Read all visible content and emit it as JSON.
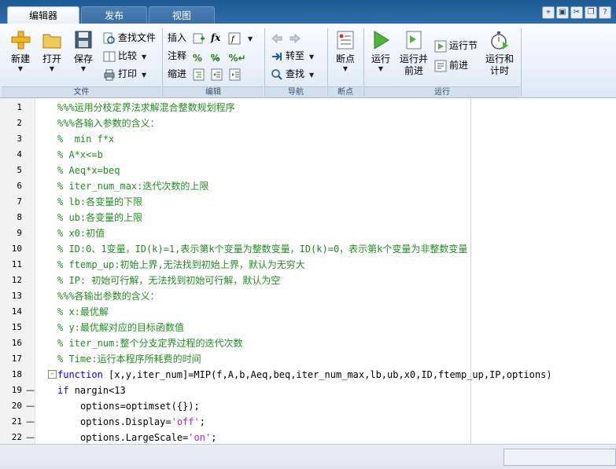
{
  "tabs": [
    {
      "label": "编辑器",
      "active": true
    },
    {
      "label": "发布",
      "active": false
    },
    {
      "label": "视图",
      "active": false
    }
  ],
  "quick_access_icons": [
    "pin-icon",
    "save-icon",
    "cut-icon",
    "copy-icon",
    "help-icon"
  ],
  "ribbon": {
    "file": {
      "group_label": "文件",
      "new": "新建",
      "open": "打开",
      "save": "保存",
      "find_file": "查找文件",
      "compare": "比较",
      "print": "打印"
    },
    "edit": {
      "group_label": "编辑",
      "insert": "插入",
      "comment": "注释",
      "indent": "缩进",
      "fx": "fx"
    },
    "navigate": {
      "group_label": "导航",
      "goto": "转至",
      "find": "查找"
    },
    "breakpoints": {
      "group_label": "断点",
      "breakpoints": "断点"
    },
    "run": {
      "group_label": "运行",
      "run": "运行",
      "run_advance": "运行并\n前进",
      "run_section": "运行节",
      "advance": "前进",
      "run_time": "运行和\n计时"
    }
  },
  "editor": {
    "lines": [
      {
        "n": "1",
        "segments": [
          {
            "t": "%%%运用分枝定界法求解混合整数规划程序",
            "c": "comment"
          }
        ]
      },
      {
        "n": "2",
        "segments": [
          {
            "t": "%%%各输入参数的含义：",
            "c": "comment"
          }
        ]
      },
      {
        "n": "3",
        "segments": [
          {
            "t": "%  min f*x",
            "c": "comment"
          }
        ]
      },
      {
        "n": "4",
        "segments": [
          {
            "t": "% A*x<=b",
            "c": "comment"
          }
        ]
      },
      {
        "n": "5",
        "segments": [
          {
            "t": "% Aeq*x=beq",
            "c": "comment"
          }
        ]
      },
      {
        "n": "6",
        "segments": [
          {
            "t": "% iter_num_max:迭代次数的上限",
            "c": "comment"
          }
        ]
      },
      {
        "n": "7",
        "segments": [
          {
            "t": "% lb:各变量的下限",
            "c": "comment"
          }
        ]
      },
      {
        "n": "8",
        "segments": [
          {
            "t": "% ub:各变量的上限",
            "c": "comment"
          }
        ]
      },
      {
        "n": "9",
        "segments": [
          {
            "t": "% x0:初值",
            "c": "comment"
          }
        ]
      },
      {
        "n": "10",
        "segments": [
          {
            "t": "% ID:0、1变量，ID(k)=1,表示第k个变量为整数变量，ID(k)=0，表示第k个变量为非整数变量",
            "c": "comment"
          }
        ]
      },
      {
        "n": "11",
        "segments": [
          {
            "t": "% ftemp_up:初始上界,无法找到初始上界，默认为无穷大",
            "c": "comment"
          }
        ]
      },
      {
        "n": "12",
        "segments": [
          {
            "t": "% IP: 初始可行解，无法找到初始可行解，默认为空",
            "c": "comment"
          }
        ]
      },
      {
        "n": "13",
        "segments": [
          {
            "t": "%%%各输出参数的含义：",
            "c": "comment"
          }
        ]
      },
      {
        "n": "14",
        "segments": [
          {
            "t": "% x:最优解",
            "c": "comment"
          }
        ]
      },
      {
        "n": "15",
        "segments": [
          {
            "t": "% y:最优解对应的目标函数值",
            "c": "comment"
          }
        ]
      },
      {
        "n": "16",
        "segments": [
          {
            "t": "% iter_num:整个分支定界过程的迭代次数",
            "c": "comment"
          }
        ]
      },
      {
        "n": "17",
        "segments": [
          {
            "t": "% Time:运行本程序所耗费的时间",
            "c": "comment"
          }
        ]
      },
      {
        "n": "18",
        "fold": "-",
        "segments": [
          {
            "t": "function",
            "c": "kw"
          },
          {
            "t": " [x,y,iter_num]=MIP(f,A,b,Aeq,beq,iter_num_max,lb,ub,x0,ID,ftemp_up,IP,options)",
            "c": "plain"
          }
        ]
      },
      {
        "n": "19",
        "dash": "—",
        "segments": [
          {
            "t": "if",
            "c": "kw"
          },
          {
            "t": " nargin<13",
            "c": "plain"
          }
        ]
      },
      {
        "n": "20",
        "dash": "—",
        "indent": true,
        "segments": [
          {
            "t": "options=optimset({});",
            "c": "plain"
          }
        ]
      },
      {
        "n": "21",
        "dash": "—",
        "indent": true,
        "segments": [
          {
            "t": "options.Display=",
            "c": "plain"
          },
          {
            "t": "'off'",
            "c": "str"
          },
          {
            "t": ";",
            "c": "plain"
          }
        ]
      },
      {
        "n": "22",
        "dash": "—",
        "indent": true,
        "segments": [
          {
            "t": "options.LargeScale=",
            "c": "plain"
          },
          {
            "t": "'on'",
            "c": "str"
          },
          {
            "t": ";",
            "c": "plain"
          }
        ]
      }
    ]
  },
  "colors": {
    "comment": "#228b22",
    "keyword": "#0000ff",
    "string": "#a020f0",
    "tabbar": "#1f5a93"
  }
}
